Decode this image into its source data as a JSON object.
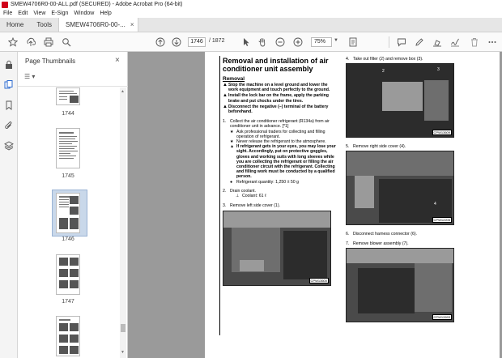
{
  "window": {
    "title": "SMEW4706R0-00-ALL.pdf (SECURED) - Adobe Acrobat Pro (64-bit)"
  },
  "menu": [
    "File",
    "Edit",
    "View",
    "E-Sign",
    "Window",
    "Help"
  ],
  "tabs": {
    "home": "Home",
    "tools": "Tools",
    "document": "SMEW4706R0-00-...",
    "close": "×"
  },
  "toolbar": {
    "current_page": "1746",
    "total_pages": "/ 1872",
    "zoom": "75%",
    "icons": [
      "star-icon",
      "upload-icon",
      "print-icon",
      "search-icon",
      "arrow-up-icon",
      "arrow-down-icon",
      "cursor-icon",
      "hand-icon",
      "zoom-out-icon",
      "zoom-in-icon",
      "fit-page-icon",
      "comment-icon",
      "pen-icon",
      "highlight-icon",
      "sign-icon",
      "delete-icon",
      "more-icon"
    ]
  },
  "thumbnails": {
    "title": "Page Thumbnails",
    "close": "×",
    "options": "☰ ▾",
    "pages": [
      {
        "label": "1744"
      },
      {
        "label": "1745"
      },
      {
        "label": "1746",
        "selected": true
      },
      {
        "label": "1747"
      },
      {
        "label": ""
      }
    ]
  },
  "page": {
    "heading": "Removal and installation of air conditioner unit assembly",
    "section": "Removal",
    "warnings": [
      "Stop the machine on a level ground and lower the work equipment and touch perfectly to the ground.",
      "Install the lock bar on the frame, apply the parking brake and put chocks under the tires.",
      "Disconnect the negative (–) terminal of the battery beforehand."
    ],
    "step1": {
      "num": "1.",
      "text": "Collect the air conditioner refrigerant (R134a) from air conditioner unit in advance.     [*1]",
      "sub1": "Ask professional traders for collecting and filling operation of refrigerant.",
      "sub2": "Never release the refrigerant to the atmosphere.",
      "warning": "If refrigerant gets in your eyes, you may lose your sight. Accordingly, put on protective goggles, gloves and working suits with long sleeves while you are collecting the refrigerant or filling the air conditioner circuit with the refrigerant. Collecting and filling work must be conducted by a qualified person.",
      "quantity": "Refrigerant quantity: 1,250 ± 50 g"
    },
    "step2": {
      "num": "2.",
      "text": "Drain coolant.",
      "coolant": "Coolant: 61 ℓ"
    },
    "step3": {
      "num": "3.",
      "text": "Remove left side cover (1).",
      "code": "CPW13600"
    },
    "step4": {
      "num": "4.",
      "text": "Take out filter (2) and remove box (3).",
      "code": "CPW13609",
      "l2": "2",
      "l3": "3"
    },
    "step5": {
      "num": "5.",
      "text": "Remove right side cover (4).",
      "code": "CPW12205",
      "l4": "4"
    },
    "step6": {
      "num": "6.",
      "text": "Disconnect harness connector (6)."
    },
    "step7": {
      "num": "7.",
      "text": "Remove blower assembly (7).",
      "code": "CPW12693"
    }
  }
}
